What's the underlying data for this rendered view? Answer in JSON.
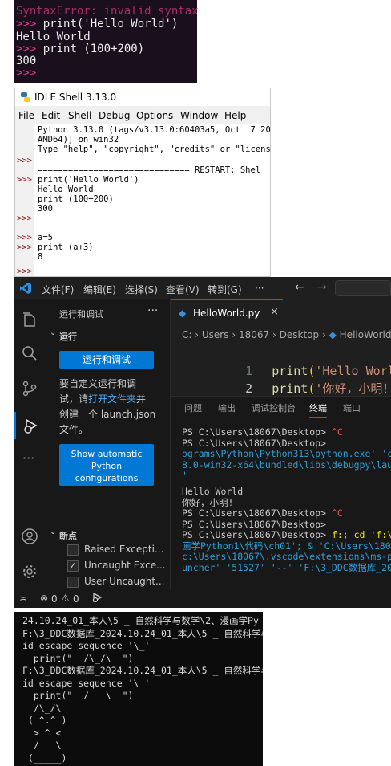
{
  "panel1": {
    "lines": [
      {
        "prompt": "",
        "text": "SyntaxError: invalid syntax"
      },
      {
        "prompt": ">>>",
        "text": " print('Hello World')"
      },
      {
        "prompt": "",
        "text": "Hello World"
      },
      {
        "prompt": ">>>",
        "text": " print (100+200)"
      },
      {
        "prompt": "",
        "text": "300"
      },
      {
        "prompt": ">>>",
        "text": ""
      }
    ]
  },
  "idle": {
    "title": "IDLE Shell 3.13.0",
    "menu": [
      "File",
      "Edit",
      "Shell",
      "Debug",
      "Options",
      "Window",
      "Help"
    ],
    "header1": "Python 3.13.0 (tags/v3.13.0:60403a5, Oct  7 20",
    "header2": "AMD64)] on win32",
    "header3": "Type \"help\", \"copyright\", \"credits\" or \"licens",
    "restart": "============================== RESTART: Shel",
    "prompt": ">>>",
    "code": {
      "c1": "print('Hello World')",
      "o1": "Hello World",
      "c2": "print (100+200)",
      "o2": "300",
      "c3": "a=5",
      "c4": "print (a+3)",
      "o3": "8"
    }
  },
  "vscode": {
    "menu": [
      "文件(F)",
      "编辑(E)",
      "选择(S)",
      "查看(V)",
      "转到(G)",
      "···"
    ],
    "sidebar_title": "运行和调试",
    "sidebar_more": "···",
    "section_run": "运行",
    "run_button": "运行和调试",
    "desc_line1": "要自定义运行和调",
    "desc_line2a": "试，请",
    "desc_link": "打开文件夹",
    "desc_line2b": "并",
    "desc_line3": "创建一个 launch.json",
    "desc_line4": "文件。",
    "python_button": [
      "Show automatic",
      "Python",
      "configurations"
    ],
    "section_breakpoints": "断点",
    "breakpoints": [
      {
        "label": "Raised Excepti...",
        "checked": false
      },
      {
        "label": "Uncaught Exce...",
        "checked": true
      },
      {
        "label": "User Uncaught...",
        "checked": false
      }
    ],
    "tab_name": "HelloWorld.py",
    "breadcrumb": [
      "C:",
      "Users",
      "18067",
      "Desktop",
      "HelloWorld.py"
    ],
    "code_lines": [
      {
        "no": "1",
        "fn": "print",
        "open": "(",
        "str": "'Hello World'",
        "close": ")"
      },
      {
        "no": "2",
        "fn": "print",
        "open": "(",
        "str": "'你好，小明！'",
        "close": ")"
      }
    ],
    "panel_tabs": [
      "问题",
      "输出",
      "调试控制台",
      "终端",
      "端口"
    ],
    "active_tab": "终端",
    "terminal": {
      "t1": "PS C:\\Users\\18067\\Desktop> ",
      "t1b": "^C",
      "t2": "PS C:\\Users\\18067\\Desktop>",
      "t3": "ograms\\Python\\Python313\\python.exe' 'c:\\",
      "t4": "8.0-win32-x64\\bundled\\libs\\debugpy\\launc",
      "t5": "'",
      "t6": "Hello World",
      "t7": "你好，小明!",
      "t8": "PS C:\\Users\\18067\\Desktop> ",
      "t8b": "^C",
      "t9": "PS C:\\Users\\18067\\Desktop>",
      "t10": "PS C:\\Users\\18067\\Desktop> ",
      "t10b": "f:; cd 'f:\\3",
      "t11": "画学Python1\\代码\\ch01'; & 'C:\\Users\\1806",
      "t12": "c:\\Users\\18067\\.vscode\\extensions\\ms-pyt",
      "t13": "uncher' '51527' '--' 'F:\\3_DDC数据库_202"
    },
    "status": {
      "errors": "0",
      "warnings": "0"
    }
  },
  "panel4": {
    "lines": [
      "24.10.24_01_本人\\5 _ 自然科学与数学\\2、漫画学Py",
      "F:\\3_DDC数据库_2024.10.24_01_本人\\5 _ 自然科学与",
      "id escape sequence '\\_'",
      "  print(\"  /\\_/\\  \")",
      "F:\\3_DDC数据库_2024.10.24_01_本人\\5 _ 自然科学与",
      "id escape sequence '\\ '",
      "  print(\"  /   \\  \")",
      "  /\\_/\\",
      " ( ^.^ )",
      "  > ^ <",
      "  /   \\",
      " (_____)"
    ]
  }
}
